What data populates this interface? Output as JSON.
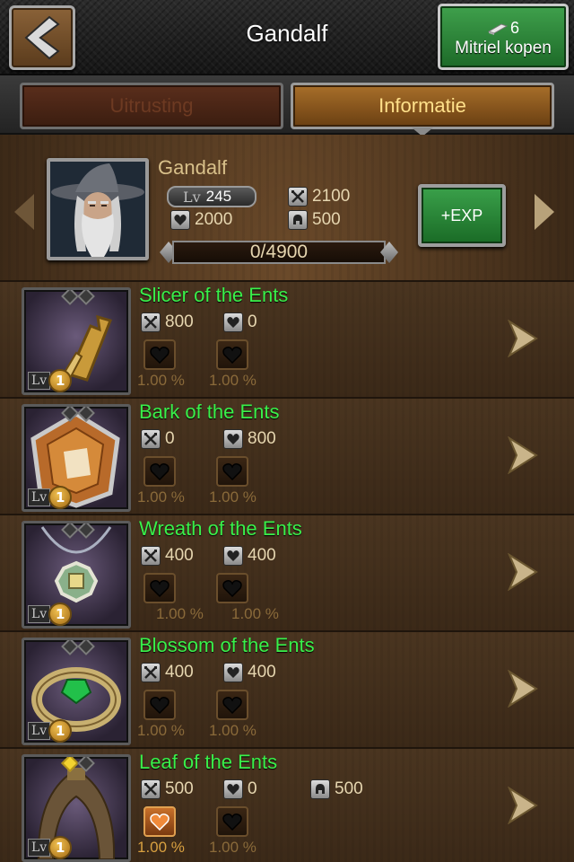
{
  "header": {
    "title": "Gandalf",
    "mithril_count": "6",
    "buy_label": "Mitriel kopen"
  },
  "tabs": [
    {
      "label": "Uitrusting",
      "active": false
    },
    {
      "label": "Informatie",
      "active": true
    }
  ],
  "hero": {
    "name": "Gandalf",
    "level_label": "Lv",
    "level": "245",
    "attack": "2100",
    "health": "2000",
    "defense": "500",
    "exp": "0/4900",
    "exp_button": "+EXP"
  },
  "items": [
    {
      "name": "Slicer of the Ents",
      "attack": "800",
      "health": "0",
      "defense": null,
      "level": "1",
      "sockets": [
        "empty",
        "empty"
      ],
      "slots": [
        {
          "active": false,
          "pct": "1.00 %"
        },
        {
          "active": false,
          "pct": "1.00 %"
        }
      ]
    },
    {
      "name": "Bark of the Ents",
      "attack": "0",
      "health": "800",
      "defense": null,
      "level": "1",
      "sockets": [
        "empty",
        "empty"
      ],
      "slots": [
        {
          "active": false,
          "pct": "1.00 %"
        },
        {
          "active": false,
          "pct": "1.00 %"
        }
      ]
    },
    {
      "name": "Wreath of the Ents",
      "attack": "400",
      "health": "400",
      "defense": null,
      "level": "1",
      "sockets": [
        "empty",
        "empty"
      ],
      "slots": [
        {
          "active": false,
          "pct": "1.00 %"
        },
        {
          "active": false,
          "pct": "1.00 %"
        }
      ]
    },
    {
      "name": "Blossom of the Ents",
      "attack": "400",
      "health": "400",
      "defense": null,
      "level": "1",
      "sockets": [
        "empty",
        "empty"
      ],
      "slots": [
        {
          "active": false,
          "pct": "1.00 %"
        },
        {
          "active": false,
          "pct": "1.00 %"
        }
      ]
    },
    {
      "name": "Leaf of the Ents",
      "attack": "500",
      "health": "0",
      "defense": "500",
      "level": "1",
      "sockets": [
        "filled",
        "empty"
      ],
      "slots": [
        {
          "active": true,
          "pct": "1.00 %"
        },
        {
          "active": false,
          "pct": "1.00 %"
        }
      ]
    }
  ],
  "icons": {
    "back": "chevron-left-icon",
    "attack": "crossed-swords-icon",
    "health": "heart-icon",
    "defense": "helmet-icon",
    "mithril": "mithril-ingot-icon"
  },
  "colors": {
    "item_name": "#39f04a",
    "active_tab_text": "#ffe08a",
    "inactive_tab_text": "#6d3a22",
    "green_button": "#2a8a38"
  }
}
